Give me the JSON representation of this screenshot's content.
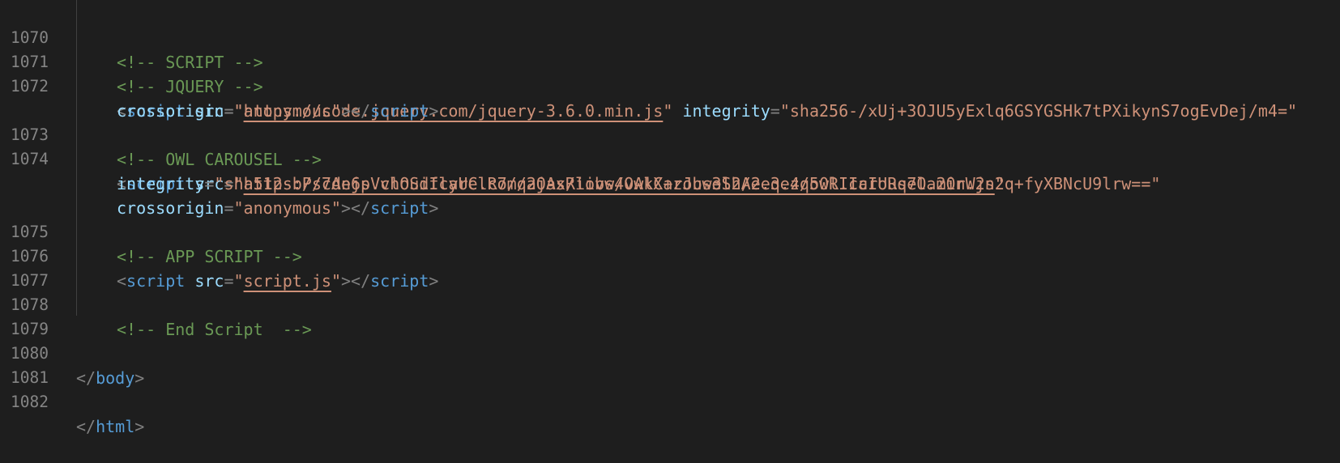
{
  "editor": {
    "colors": {
      "background": "#1e1e1e",
      "line_number": "#858585",
      "comment": "#6a9955",
      "punctuation": "#808080",
      "tag": "#569cd6",
      "attribute": "#9cdcfe",
      "string": "#ce9178"
    },
    "lines": [
      {
        "number": "1070",
        "comment": "<!-- SCRIPT -->"
      },
      {
        "number": "1071",
        "comment": "<!-- JQUERY -->"
      },
      {
        "number": "1072",
        "tag": "script",
        "src_attr": "src",
        "src_value": "https://code.jquery.com/jquery-3.6.0.min.js",
        "integrity_attr": "integrity",
        "integrity_value": "sha256-/xUj+3OJU5yExlq6GSYGSHk7tPXikynS7ogEvDej/m4=",
        "crossorigin_attr": "crossorigin",
        "crossorigin_value": "anonymous"
      },
      {
        "number": "1073",
        "comment": "<!-- OWL CAROUSEL -->"
      },
      {
        "number": "1074",
        "tag": "script",
        "src_attr": "src",
        "src_value": "https://cdnjs.cloudflare.com/ajax/libs/OwlCarousel2/2.3.4/owl.carousel.min.js",
        "integrity_attr": "integrity",
        "integrity_value": "sha512-bPs7Ae6pVvhOSiIcyUClR7/q2OAsRiovw4vAkX+zJbw3ShAeeqezq50RIIcIURq7Oa20rW2n2q+fyXBNcU9lrw==",
        "crossorigin_attr": "crossorigin",
        "crossorigin_value": "anonymous"
      },
      {
        "number": "1075",
        "comment": "<!-- APP SCRIPT -->"
      },
      {
        "number": "1076",
        "tag": "script",
        "src_attr": "src",
        "src_value": "script.js"
      },
      {
        "number": "1077"
      },
      {
        "number": "1078",
        "comment": "<!-- End Script  -->"
      },
      {
        "number": "1079"
      },
      {
        "number": "1080",
        "close_tag": "body"
      },
      {
        "number": "1081"
      },
      {
        "number": "1082",
        "close_tag": "html"
      }
    ]
  }
}
